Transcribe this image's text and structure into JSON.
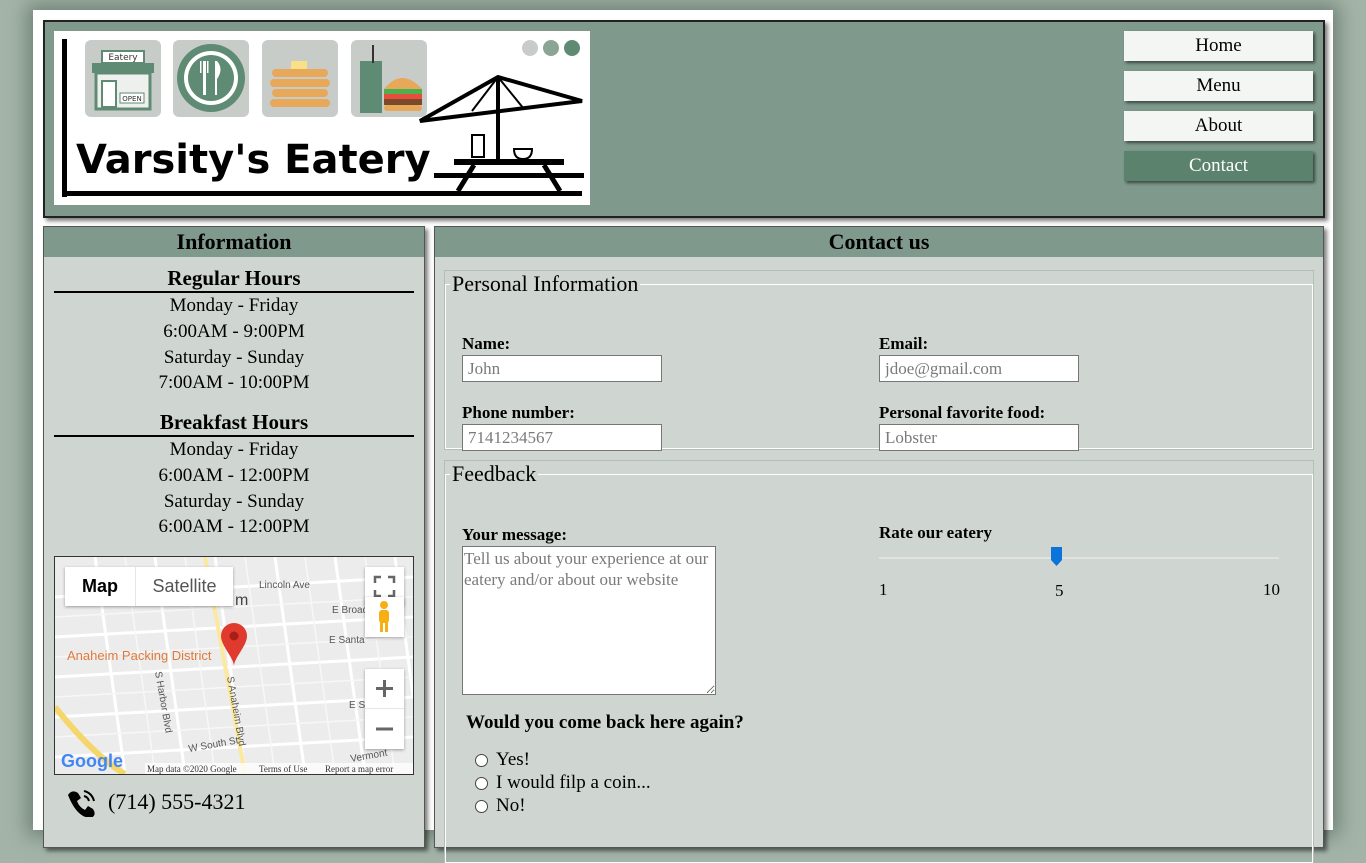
{
  "logo": {
    "title": "Varsity's Eatery",
    "eatery_sign": "Eatery",
    "open_sign": "OPEN"
  },
  "nav": {
    "items": [
      {
        "label": "Home"
      },
      {
        "label": "Menu"
      },
      {
        "label": "About"
      },
      {
        "label": "Contact",
        "active": true
      }
    ]
  },
  "sidebar": {
    "title": "Information",
    "regular_hours": {
      "title": "Regular Hours",
      "lines": [
        "Monday - Friday",
        "6:00AM - 9:00PM",
        "Saturday - Sunday",
        "7:00AM - 10:00PM"
      ]
    },
    "breakfast_hours": {
      "title": "Breakfast Hours",
      "lines": [
        "Monday - Friday",
        "6:00AM - 12:00PM",
        "Saturday - Sunday",
        "6:00AM - 12:00PM"
      ]
    },
    "map": {
      "tab_map": "Map",
      "tab_satellite": "Satellite",
      "place_label": "Anaheim Packing District",
      "streets": [
        "Lincoln Ave",
        "E Broad",
        "E Santa",
        "S Harbor Blvd",
        "S Anaheim Blvd",
        "W South St",
        "Vermont",
        "E S"
      ],
      "partial_label": "m",
      "google_logo": "Google",
      "map_data": "Map data ©2020 Google",
      "terms": "Terms of Use",
      "report": "Report a map error"
    },
    "phone": "(714) 555-4321"
  },
  "contact": {
    "title": "Contact us",
    "personal": {
      "legend": "Personal Information",
      "name_label": "Name:",
      "name_placeholder": "John",
      "email_label": "Email:",
      "email_placeholder": "jdoe@gmail.com",
      "phone_label": "Phone number:",
      "phone_placeholder": "7141234567",
      "food_label": "Personal favorite food:",
      "food_placeholder": "Lobster"
    },
    "feedback": {
      "legend": "Feedback",
      "message_label": "Your message:",
      "message_placeholder": "Tell us about your experience at our eatery and/or about our website",
      "rate_label": "Rate our eatery",
      "rate_min": "1",
      "rate_value": "5",
      "rate_max": "10",
      "come_back_question": "Would you come back here again?",
      "options": [
        "Yes!",
        "I would filp a coin...",
        "No!"
      ]
    }
  },
  "colors": {
    "header_bg": "#7f9a8c",
    "panel_bg": "#cfd6d2",
    "active_nav": "#5b826c",
    "slider_thumb": "#0a74da",
    "map_pin": "#e03a2f"
  }
}
